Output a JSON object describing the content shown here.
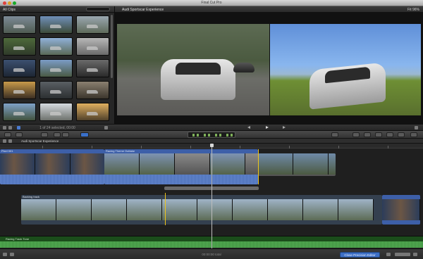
{
  "window": {
    "title": "Final Cut Pro"
  },
  "browser": {
    "header_label": "All Clips",
    "clip_count_text": "1 of 24 selected, 00:00",
    "clip_thumbnails": [
      "track-day-car",
      "car-on-road",
      "track-aerial",
      "car-front",
      "pit-lane",
      "silver-car",
      "cockpit-view",
      "car-on-track",
      "sky-view",
      "sunset-track",
      "car-detail",
      "track-corner",
      "car-driving",
      "road-curve",
      "landscape-sun"
    ]
  },
  "viewer": {
    "title": "Audi Sportscar Experience",
    "zoom_label": "Fit",
    "zoom_value": "96%"
  },
  "timeline": {
    "project_name": "Audi Sportscar Experience",
    "storyline_top_label": "Racing Theme Outtake",
    "storyline_bottom_label": "Backing track",
    "left_clip_label": "Pixel 001",
    "audio_track_label": "Racing Track Tone"
  },
  "status_bar": {
    "info_text": "00:00:00 total",
    "precision_editor_label": "Close Precision Editor"
  },
  "colors": {
    "accent_blue": "#3d6fc6",
    "clip_blue": "#4c6fb5",
    "audio_green": "#3e8e3e",
    "edit_yellow": "#f0c419"
  }
}
